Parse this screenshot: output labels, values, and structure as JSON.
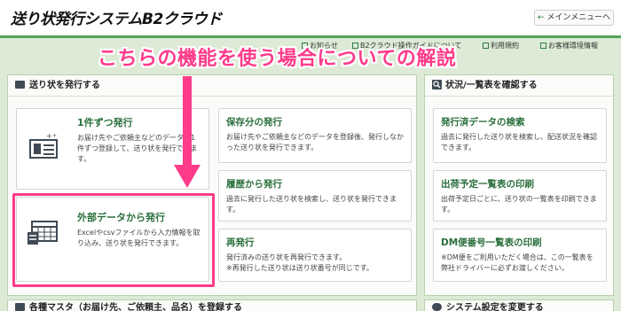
{
  "header": {
    "logo_text": "送り状発行システムB2クラウド",
    "menu_label": "メインメニューへ",
    "menu_arrow": "←"
  },
  "toplinks": [
    {
      "label": "お知らせ"
    },
    {
      "label": "B2クラウド操作ガイドについて"
    },
    {
      "label": "利用規約"
    },
    {
      "label": "お客様環境情報"
    }
  ],
  "banner": {
    "text": "こちらの機能を使う場合についての解説",
    "color": "#ff3b8a"
  },
  "panels": {
    "issue": {
      "title": "送り状を発行する",
      "icon": "printer-icon",
      "cards": {
        "one_by_one": {
          "title": "1件ずつ発行",
          "desc": "お届け先やご依頼主などのデータを1件ずつ登録して、送り状を発行できます。",
          "icon": "form-card-icon"
        },
        "external": {
          "title": "外部データから発行",
          "desc": "Excelやcsvファイルから入力情報を取り込み、送り状を発行できます。",
          "icon": "spreadsheet-calendar-icon"
        },
        "saved": {
          "title": "保存分の発行",
          "desc": "お届け先やご依頼主などのデータを登録後、発行しなかった送り状を発行できます。"
        },
        "history": {
          "title": "履歴から発行",
          "desc": "過去に発行した送り状を検索し、送り状を発行できます。"
        },
        "reissue": {
          "title": "再発行",
          "desc": "発行済みの送り状を再発行できます。",
          "note": "※再発行した送り状は送り状番号が同じです。"
        }
      }
    },
    "status": {
      "title": "状況/一覧表を確認する",
      "icon": "magnifier-icon",
      "cards": {
        "search": {
          "title": "発行済データの検索",
          "desc": "過去に発行した送り状を検索し、配送状況を確認できます。"
        },
        "schedule": {
          "title": "出荷予定一覧表の印刷",
          "desc": "出荷予定日ごとに、送り状の一覧表を印刷できます。"
        },
        "dm": {
          "title": "DM便番号一覧表の印刷",
          "desc": "※DM便をご利用いただく場合は、この一覧表を弊社ドライバーに必ずお渡しください。"
        }
      }
    },
    "master": {
      "title": "各種マスタ（お届け先、ご依頼主、品名）を登録する"
    },
    "settings": {
      "title": "システム設定を変更する"
    }
  },
  "colors": {
    "accent_green": "#2a6f3c",
    "highlight_pink": "#ff3b8a",
    "band_green": "#dcead6"
  }
}
